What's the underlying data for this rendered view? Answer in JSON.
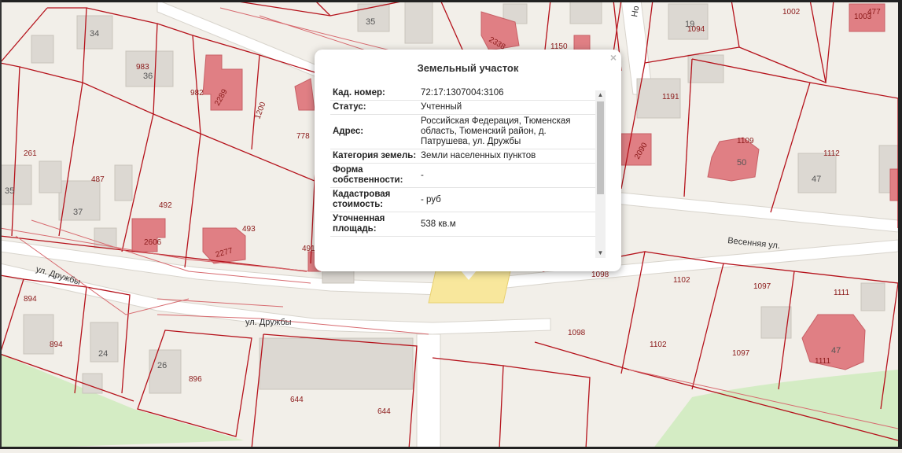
{
  "map": {
    "streets": {
      "druzhby_upper": "ул. Дружбы",
      "druzhby_lower": "ул. Дружбы",
      "vesennyaya": "Весенняя ул.",
      "top_street_fragment": "Но"
    },
    "parcel_numbers": {
      "p983": "983",
      "p982": "982",
      "p1200": "1200",
      "p778": "778",
      "p261": "261",
      "p487": "487",
      "p492": "492",
      "p493": "493",
      "p491": "491",
      "p894a": "894",
      "p894b": "894",
      "p896": "896",
      "p644a": "644",
      "p644b": "644",
      "p1150": "1150",
      "p1002": "1002",
      "p1094": "1094",
      "p1003": "1003",
      "p1191": "1191",
      "p1109": "1109",
      "p1112": "1112",
      "p1098a": "1098",
      "p1098b": "1098",
      "p1102a": "1102",
      "p1102b": "1102",
      "p1097a": "1097",
      "p1097b": "1097",
      "p1111a": "1111",
      "p1111b": "1111",
      "p2289": "2289",
      "p2606": "2606",
      "p2277": "2277",
      "p2338": "2338",
      "p2090": "2090",
      "p477": "477"
    },
    "house_numbers": {
      "h34": "34",
      "h36": "36",
      "h35a": "35",
      "h35b": "35",
      "h37": "37",
      "h24": "24",
      "h26": "26",
      "h19": "19",
      "h47a": "47",
      "h47b": "47",
      "h50": "50"
    },
    "colors": {
      "background": "#f2efe9",
      "parcel_border": "#b5121b",
      "building": "#dcd8d2",
      "registered_building": "#e07f84",
      "selected_parcel": "#f8e79c",
      "green_area": "#d4ecc4",
      "road": "#ffffff"
    }
  },
  "popup": {
    "title": "Земельный участок",
    "close_label": "×",
    "rows": [
      {
        "label": "Кад. номер:",
        "value": "72:17:1307004:3106"
      },
      {
        "label": "Статус:",
        "value": "Учтенный"
      },
      {
        "label": "Адрес:",
        "value": "Российская Федерация, Тюменская область, Тюменский район, д. Патрушева, ул. Дружбы"
      },
      {
        "label": "Категория земель:",
        "value": "Земли населенных пунктов"
      },
      {
        "label": "Форма собственности:",
        "value": "-"
      },
      {
        "label": "Кадастровая стоимость:",
        "value": "- руб"
      },
      {
        "label": "Уточненная площадь:",
        "value": "538 кв.м"
      }
    ],
    "scroll_up_icon": "▲",
    "scroll_down_icon": "▼"
  }
}
